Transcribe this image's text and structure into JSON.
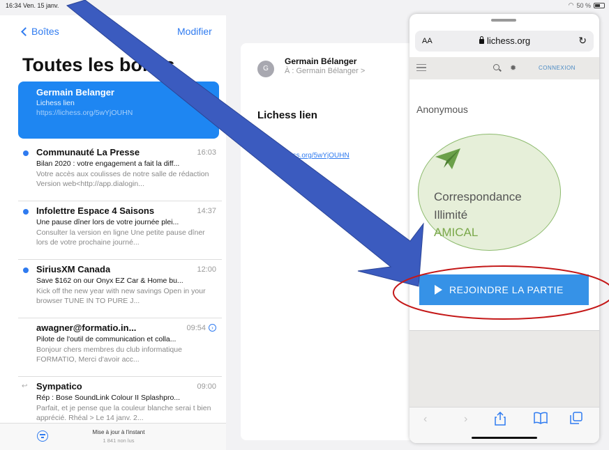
{
  "status_bar": {
    "time": "16:34 Ven. 15 janv.",
    "battery": "50 %"
  },
  "mail_list": {
    "back_label": "Boîtes",
    "edit_label": "Modifier",
    "title": "Toutes les boîtes",
    "selected": {
      "sender": "Germain Belanger",
      "subject": "Lichess lien",
      "preview": "https://lichess.org/5wYjOUHN"
    },
    "items": [
      {
        "sender": "Communauté La Presse",
        "time": "16:03",
        "subject": "Bilan 2020 : votre engagement a fait la diff...",
        "preview": "Votre accès aux coulisses de notre salle de rédaction Version web<http://app.dialogin..."
      },
      {
        "sender": "Infolettre Espace 4 Saisons",
        "time": "14:37",
        "subject": "Une pause dîner lors de votre journée plei...",
        "preview": "Consulter la version en ligne Une petite pause dîner lors de votre prochaine journé..."
      },
      {
        "sender": "SiriusXM Canada",
        "time": "12:00",
        "subject": "Save $162 on our Onyx EZ Car & Home bu...",
        "preview": "Kick off the new year with new savings Open in your browser TUNE IN TO PURE J..."
      },
      {
        "sender": "awagner@formatio.in...",
        "time": "09:54",
        "subject": "Pilote de l'outil de communication et colla...",
        "preview": "Bonjour chers membres du club informatique FORMATIO, Merci d'avoir acc..."
      },
      {
        "sender": "Sympatico",
        "time": "09:00",
        "subject": "Rép : Bose SoundLink Colour II Splashpro...",
        "preview": "Parfait, et je pense que la couleur blanche serai t bien apprécié. Rhéal > Le 14 janv. 2..."
      }
    ],
    "footer": {
      "updated": "Mise à jour à l'instant",
      "unread": "1 841 non lus"
    }
  },
  "message": {
    "avatar_initial": "G",
    "from": "Germain Bélanger",
    "to": "À : Germain Bélanger >",
    "subject": "Lichess lien",
    "link": "https://lichess.org/5wYjOUHN"
  },
  "safari": {
    "aa_label": "AA",
    "url": "lichess.org",
    "nav_connexion": "CONNEXION",
    "anonymous": "Anonymous",
    "challenge_line1": "Correspondance",
    "challenge_line2": "Illimité",
    "challenge_line3": "AMICAL",
    "join_label": "REJOINDRE LA PARTIE"
  },
  "colors": {
    "ios_blue": "#2f7bf0",
    "selected_row": "#1e86f2",
    "join_button": "#3692e7",
    "challenge_bg": "#e6efd9",
    "challenge_green": "#7aa84a",
    "annotation_arrow": "#3b5bbf",
    "annotation_ring": "#c41818"
  }
}
